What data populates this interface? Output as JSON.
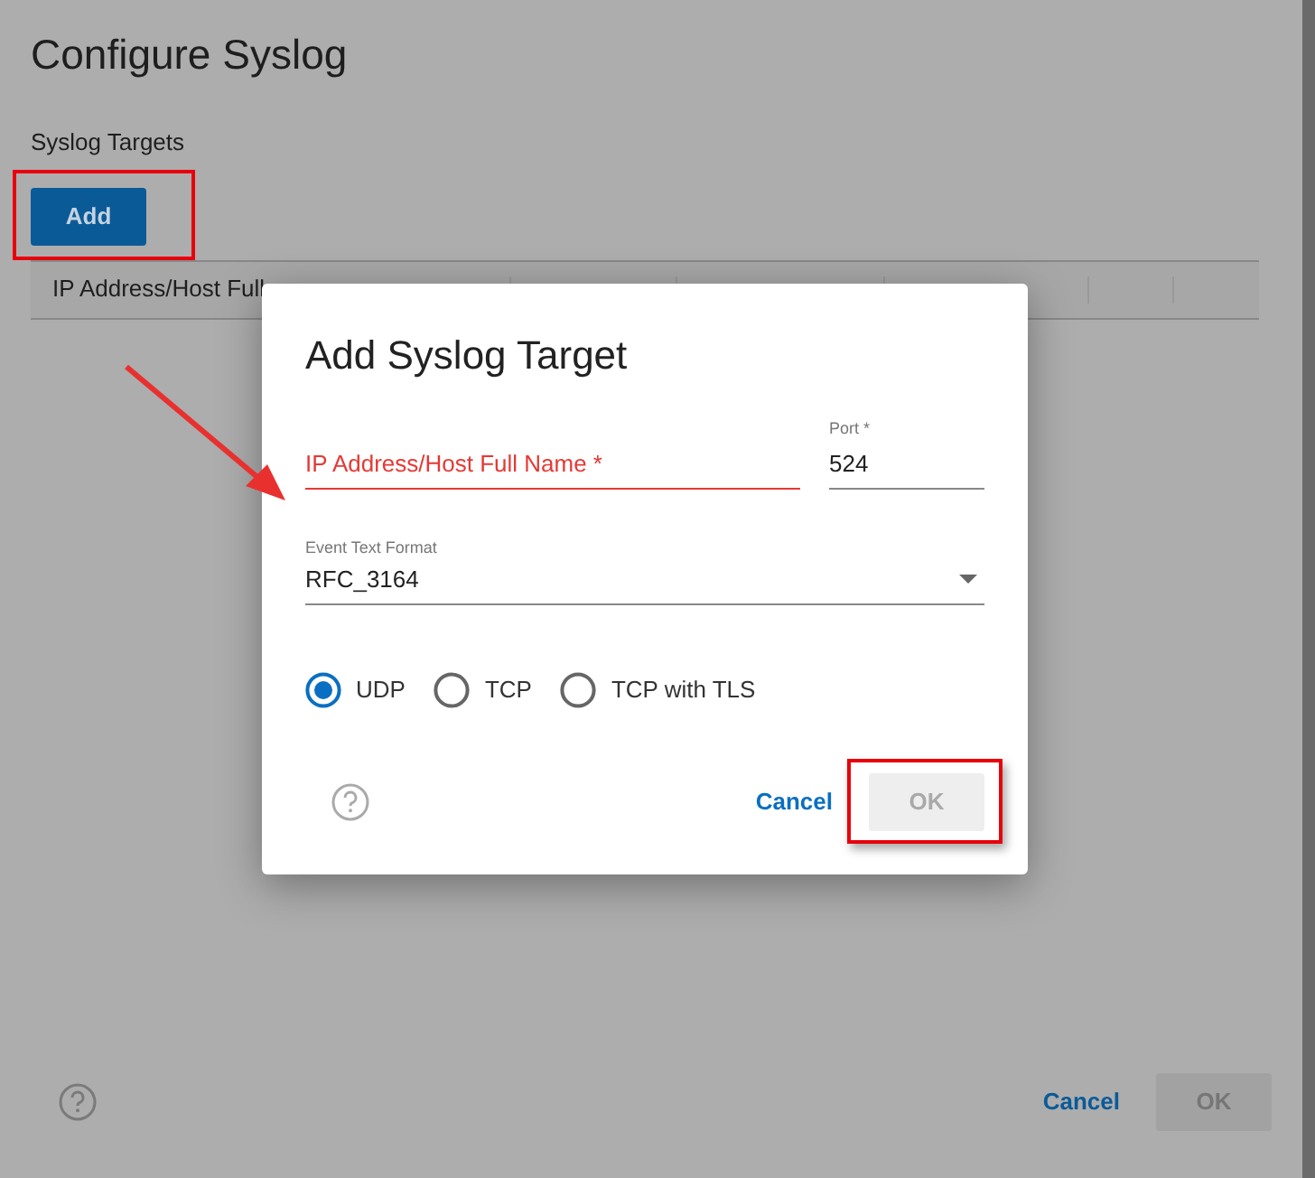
{
  "page": {
    "title": "Configure Syslog",
    "section_label": "Syslog Targets",
    "add_button": "Add",
    "table": {
      "columns": [
        "IP Address/Host Full",
        "",
        "",
        "",
        "",
        ""
      ]
    },
    "cancel": "Cancel",
    "ok": {
      "label": "OK",
      "disabled": true
    }
  },
  "dialog": {
    "title": "Add Syslog Target",
    "fields": [
      {
        "kind": "text",
        "placeholder": "IP Address/Host Full Name *",
        "invalid": true
      },
      {
        "kind": "text",
        "label": "Port *",
        "value": "524",
        "invalid": false
      },
      {
        "kind": "select",
        "label": "Event Text Format",
        "value": "RFC_3164"
      }
    ],
    "protocols": [
      {
        "label": "UDP",
        "selected": true
      },
      {
        "label": "TCP",
        "selected": false
      },
      {
        "label": "TCP with TLS",
        "selected": false
      }
    ],
    "cancel": "Cancel",
    "ok": {
      "label": "OK",
      "disabled": true
    }
  },
  "annotations": [
    {
      "kind": "frame"
    },
    {
      "kind": "frame"
    },
    {
      "kind": "arrow"
    }
  ]
}
